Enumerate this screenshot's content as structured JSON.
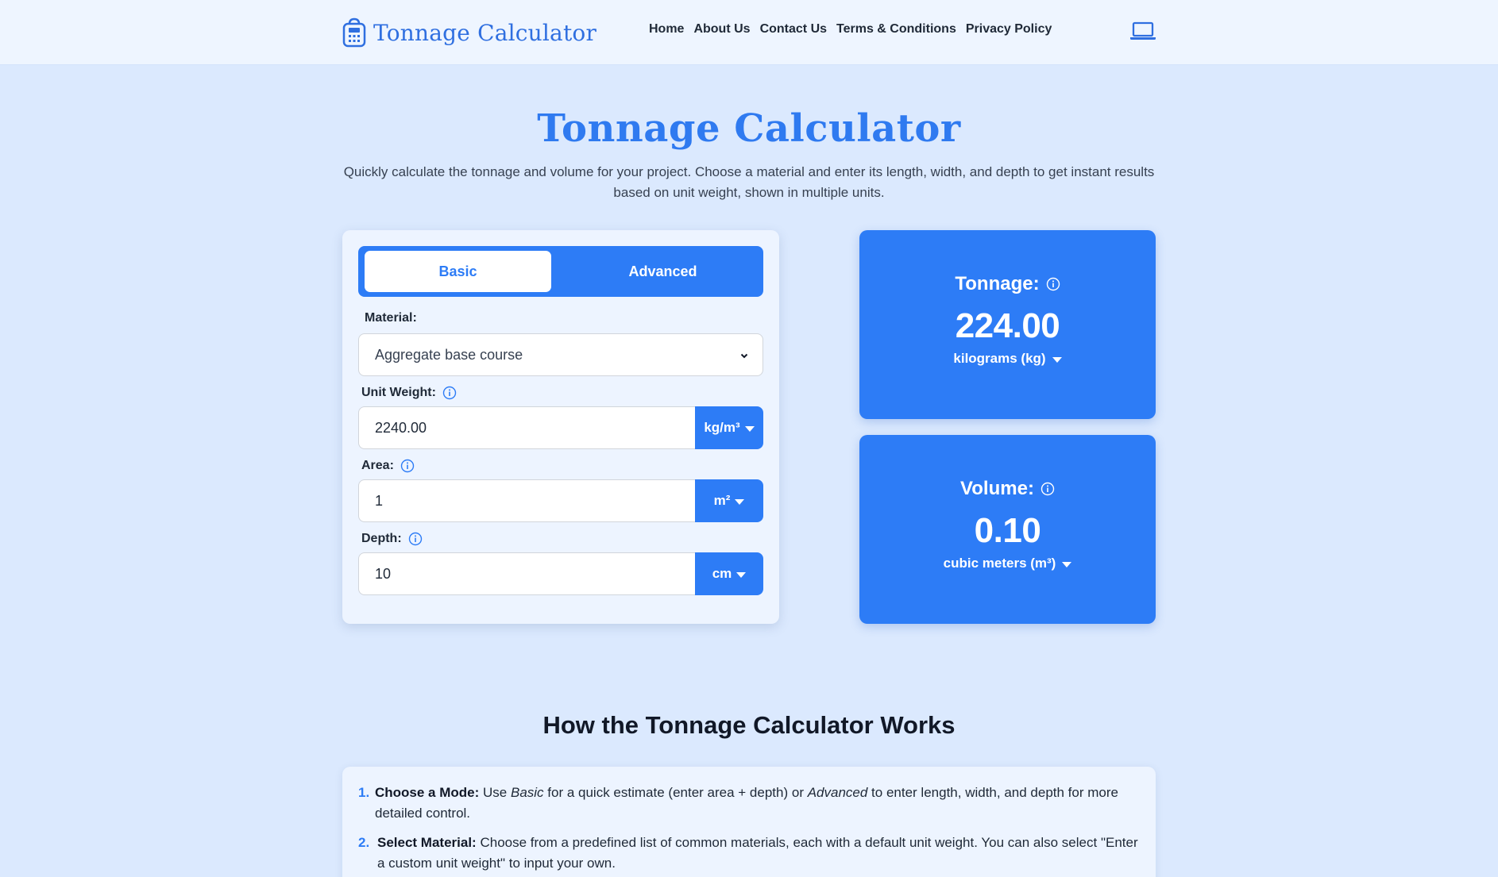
{
  "header": {
    "brand": "Tonnage Calculator",
    "nav": [
      "Home",
      "About Us",
      "Contact Us",
      "Terms & Conditions",
      "Privacy Policy"
    ],
    "theme_icon": "laptop-icon"
  },
  "hero": {
    "title": "Tonnage Calculator",
    "subtitle": "Quickly calculate the tonnage and volume for your project. Choose a material and enter its length, width, and depth to get instant results based on unit weight, shown in multiple units."
  },
  "calculator": {
    "modes": {
      "basic": "Basic",
      "advanced": "Advanced",
      "active": "basic"
    },
    "material": {
      "label": "Material:",
      "value": "Aggregate base course"
    },
    "unit_weight": {
      "label": "Unit Weight:",
      "value": "2240.00",
      "unit": "kg/m³"
    },
    "area": {
      "label": "Area:",
      "value": "1",
      "unit": "m²"
    },
    "depth": {
      "label": "Depth:",
      "value": "10",
      "unit": "cm"
    }
  },
  "results": {
    "tonnage": {
      "label": "Tonnage:",
      "value": "224.00",
      "unit": "kilograms (kg)"
    },
    "volume": {
      "label": "Volume:",
      "value": "0.10",
      "unit": "cubic meters (m³)"
    }
  },
  "how": {
    "title": "How the Tonnage Calculator Works",
    "steps": [
      {
        "num": "1.",
        "title": "Choose a Mode:",
        "text_a": " Use ",
        "em_a": "Basic",
        "text_b": " for a quick estimate (enter area + depth) or ",
        "em_b": "Advanced",
        "text_c": " to enter length, width, and depth for more detailed control."
      },
      {
        "num": "2.",
        "title": "Select Material:",
        "text_a": " Choose from a predefined list of common materials, each with a default unit weight. You can also select \"Enter a custom unit weight\" to input your own."
      }
    ]
  },
  "colors": {
    "accent": "#2d7cf6",
    "background": "#dbe9fe",
    "card": "#edf4ff"
  }
}
